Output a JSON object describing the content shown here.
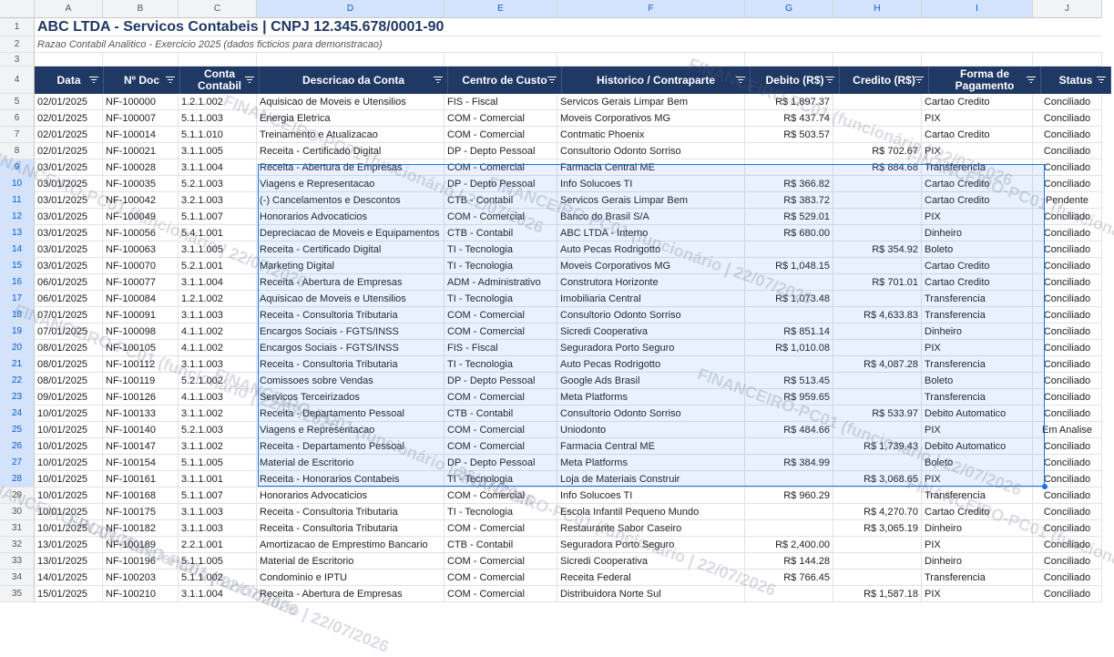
{
  "columns": [
    "A",
    "B",
    "C",
    "D",
    "E",
    "F",
    "G",
    "H",
    "I",
    "J"
  ],
  "sheet_title": "ABC LTDA - Servicos Contabeis | CNPJ 12.345.678/0001-90",
  "sheet_subtitle": "Razao Contabil Analitico - Exercicio 2025 (dados ficticios para demonstracao)",
  "headers": [
    "Data",
    "Nº Doc",
    "Conta Contabil",
    "Descricao da Conta",
    "Centro de Custo",
    "Historico / Contraparte",
    "Debito (R$)",
    "Credito (R$)",
    "Forma de Pagamento",
    "Status"
  ],
  "watermark": "FINANCEIRO-PC01 (funcionário | 22/07/2026",
  "rows": [
    [
      "02/01/2025",
      "NF-100000",
      "1.2.1.002",
      "Aquisicao de Moveis e Utensilios",
      "FIS - Fiscal",
      "Servicos Gerais Limpar Bem",
      "R$ 1,897.37",
      "",
      "Cartao Credito",
      "Conciliado"
    ],
    [
      "02/01/2025",
      "NF-100007",
      "5.1.1.003",
      "Energia Eletrica",
      "COM - Comercial",
      "Moveis Corporativos MG",
      "R$ 437.74",
      "",
      "PIX",
      "Conciliado"
    ],
    [
      "02/01/2025",
      "NF-100014",
      "5.1.1.010",
      "Treinamento e Atualizacao",
      "COM - Comercial",
      "Contmatic Phoenix",
      "R$ 503.57",
      "",
      "Cartao Credito",
      "Conciliado"
    ],
    [
      "02/01/2025",
      "NF-100021",
      "3.1.1.005",
      "Receita - Certificado Digital",
      "DP - Depto Pessoal",
      "Consultorio Odonto Sorriso",
      "",
      "R$ 702.67",
      "PIX",
      "Conciliado"
    ],
    [
      "03/01/2025",
      "NF-100028",
      "3.1.1.004",
      "Receita - Abertura de Empresas",
      "COM - Comercial",
      "Farmacia Central ME",
      "",
      "R$ 884.68",
      "Transferencia",
      "Conciliado"
    ],
    [
      "03/01/2025",
      "NF-100035",
      "5.2.1.003",
      "Viagens e Representacao",
      "DP - Depto Pessoal",
      "Info Solucoes TI",
      "R$ 366.82",
      "",
      "Cartao Credito",
      "Conciliado"
    ],
    [
      "03/01/2025",
      "NF-100042",
      "3.2.1.003",
      "(-) Cancelamentos e Descontos",
      "CTB - Contabil",
      "Servicos Gerais Limpar Bem",
      "R$ 383.72",
      "",
      "Cartao Credito",
      "Pendente"
    ],
    [
      "03/01/2025",
      "NF-100049",
      "5.1.1.007",
      "Honorarios Advocaticios",
      "COM - Comercial",
      "Banco do Brasil S/A",
      "R$ 529.01",
      "",
      "PIX",
      "Conciliado"
    ],
    [
      "03/01/2025",
      "NF-100056",
      "5.4.1.001",
      "Depreciacao de Moveis e Equipamentos",
      "CTB - Contabil",
      "ABC LTDA - Interno",
      "R$ 680.00",
      "",
      "Dinheiro",
      "Conciliado"
    ],
    [
      "03/01/2025",
      "NF-100063",
      "3.1.1.005",
      "Receita - Certificado Digital",
      "TI - Tecnologia",
      "Auto Pecas Rodrigotto",
      "",
      "R$ 354.92",
      "Boleto",
      "Conciliado"
    ],
    [
      "03/01/2025",
      "NF-100070",
      "5.2.1.001",
      "Marketing Digital",
      "TI - Tecnologia",
      "Moveis Corporativos MG",
      "R$ 1,048.15",
      "",
      "Cartao Credito",
      "Conciliado"
    ],
    [
      "06/01/2025",
      "NF-100077",
      "3.1.1.004",
      "Receita - Abertura de Empresas",
      "ADM - Administrativo",
      "Construtora Horizonte",
      "",
      "R$ 701.01",
      "Cartao Credito",
      "Conciliado"
    ],
    [
      "06/01/2025",
      "NF-100084",
      "1.2.1.002",
      "Aquisicao de Moveis e Utensilios",
      "TI - Tecnologia",
      "Imobiliaria Central",
      "R$ 1,073.48",
      "",
      "Transferencia",
      "Conciliado"
    ],
    [
      "07/01/2025",
      "NF-100091",
      "3.1.1.003",
      "Receita - Consultoria Tributaria",
      "COM - Comercial",
      "Consultorio Odonto Sorriso",
      "",
      "R$ 4,633.83",
      "Transferencia",
      "Conciliado"
    ],
    [
      "07/01/2025",
      "NF-100098",
      "4.1.1.002",
      "Encargos Sociais - FGTS/INSS",
      "COM - Comercial",
      "Sicredi Cooperativa",
      "R$ 851.14",
      "",
      "Dinheiro",
      "Conciliado"
    ],
    [
      "08/01/2025",
      "NF-100105",
      "4.1.1.002",
      "Encargos Sociais - FGTS/INSS",
      "FIS - Fiscal",
      "Seguradora Porto Seguro",
      "R$ 1,010.08",
      "",
      "PIX",
      "Conciliado"
    ],
    [
      "08/01/2025",
      "NF-100112",
      "3.1.1.003",
      "Receita - Consultoria Tributaria",
      "TI - Tecnologia",
      "Auto Pecas Rodrigotto",
      "",
      "R$ 4,087.28",
      "Transferencia",
      "Conciliado"
    ],
    [
      "08/01/2025",
      "NF-100119",
      "5.2.1.002",
      "Comissoes sobre Vendas",
      "DP - Depto Pessoal",
      "Google Ads Brasil",
      "R$ 513.45",
      "",
      "Boleto",
      "Conciliado"
    ],
    [
      "09/01/2025",
      "NF-100126",
      "4.1.1.003",
      "Servicos Terceirizados",
      "COM - Comercial",
      "Meta Platforms",
      "R$ 959.65",
      "",
      "Transferencia",
      "Conciliado"
    ],
    [
      "10/01/2025",
      "NF-100133",
      "3.1.1.002",
      "Receita - Departamento Pessoal",
      "CTB - Contabil",
      "Consultorio Odonto Sorriso",
      "",
      "R$ 533.97",
      "Debito Automatico",
      "Conciliado"
    ],
    [
      "10/01/2025",
      "NF-100140",
      "5.2.1.003",
      "Viagens e Representacao",
      "COM - Comercial",
      "Uniodonto",
      "R$ 484.66",
      "",
      "PIX",
      "Em Analise"
    ],
    [
      "10/01/2025",
      "NF-100147",
      "3.1.1.002",
      "Receita - Departamento Pessoal",
      "COM - Comercial",
      "Farmacia Central ME",
      "",
      "R$ 1,739.43",
      "Debito Automatico",
      "Conciliado"
    ],
    [
      "10/01/2025",
      "NF-100154",
      "5.1.1.005",
      "Material de Escritorio",
      "DP - Depto Pessoal",
      "Meta Platforms",
      "R$ 384.99",
      "",
      "Boleto",
      "Conciliado"
    ],
    [
      "10/01/2025",
      "NF-100161",
      "3.1.1.001",
      "Receita - Honorarios Contabeis",
      "TI - Tecnologia",
      "Loja de Materiais Construir",
      "",
      "R$ 3,068.65",
      "PIX",
      "Conciliado"
    ],
    [
      "10/01/2025",
      "NF-100168",
      "5.1.1.007",
      "Honorarios Advocaticios",
      "COM - Comercial",
      "Info Solucoes TI",
      "R$ 960.29",
      "",
      "Transferencia",
      "Conciliado"
    ],
    [
      "10/01/2025",
      "NF-100175",
      "3.1.1.003",
      "Receita - Consultoria Tributaria",
      "TI - Tecnologia",
      "Escola Infantil Pequeno Mundo",
      "",
      "R$ 4,270.70",
      "Cartao Credito",
      "Conciliado"
    ],
    [
      "10/01/2025",
      "NF-100182",
      "3.1.1.003",
      "Receita - Consultoria Tributaria",
      "COM - Comercial",
      "Restaurante Sabor Caseiro",
      "",
      "R$ 3,065.19",
      "Dinheiro",
      "Conciliado"
    ],
    [
      "13/01/2025",
      "NF-100189",
      "2.2.1.001",
      "Amortizacao de Emprestimo Bancario",
      "CTB - Contabil",
      "Seguradora Porto Seguro",
      "R$ 2,400.00",
      "",
      "PIX",
      "Conciliado"
    ],
    [
      "13/01/2025",
      "NF-100196",
      "5.1.1.005",
      "Material de Escritorio",
      "COM - Comercial",
      "Sicredi Cooperativa",
      "R$ 144.28",
      "",
      "Dinheiro",
      "Conciliado"
    ],
    [
      "14/01/2025",
      "NF-100203",
      "5.1.1.002",
      "Condominio e IPTU",
      "COM - Comercial",
      "Receita Federal",
      "R$ 766.45",
      "",
      "Transferencia",
      "Conciliado"
    ],
    [
      "15/01/2025",
      "NF-100210",
      "3.1.1.004",
      "Receita - Abertura de Empresas",
      "COM - Comercial",
      "Distribuidora Norte Sul",
      "",
      "R$ 1,587.18",
      "PIX",
      "Conciliado"
    ]
  ]
}
